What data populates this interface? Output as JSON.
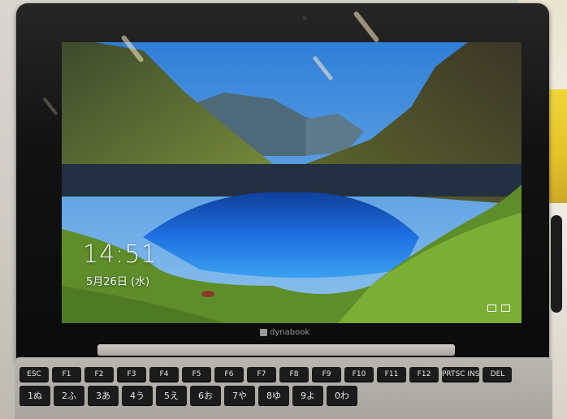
{
  "lock_screen": {
    "time": "14:51",
    "date": "5月26日 (水)"
  },
  "brand": {
    "name": "dynabook"
  },
  "keyboard": {
    "fn_row": [
      "ESC",
      "F1",
      "F2",
      "F3",
      "F4",
      "F5",
      "F6",
      "F7",
      "F8",
      "F9",
      "F10",
      "F11",
      "F12",
      "PRTSC INS",
      "DEL"
    ],
    "number_row": [
      "1ぬ",
      "2ふ",
      "3あ",
      "4う",
      "5え",
      "6お",
      "7や",
      "8ゆ",
      "9よ",
      "0わ"
    ]
  },
  "colors": {
    "sky": "#2f7fd8",
    "lake": "#1e6fe0",
    "moss": "#6b9a2e",
    "bezel": "#111111"
  }
}
